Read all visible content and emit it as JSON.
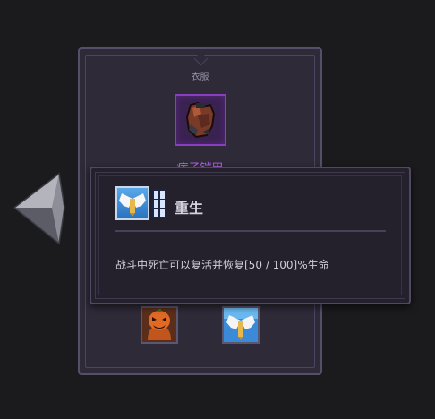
{
  "equipment": {
    "slot_label": "衣服",
    "armor_name": "痞子铠甲",
    "armor_icon": "leather-armor-icon",
    "rarity_color": "#8a3fc0",
    "runes": [
      {
        "icon": "pumpkin-rune-icon"
      },
      {
        "icon": "angel-wing-rune-icon"
      }
    ]
  },
  "navigation": {
    "prev_icon": "left-arrow-icon"
  },
  "tooltip": {
    "icon": "angel-wing-icon",
    "tier_icon": "tier-bars-icon",
    "title": "重生",
    "description": "战斗中死亡可以复活并恢复[50 / 100]%生命"
  }
}
